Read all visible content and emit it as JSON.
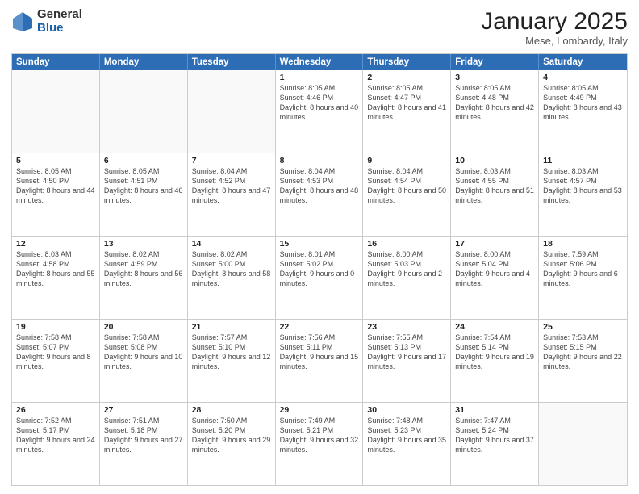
{
  "logo": {
    "general": "General",
    "blue": "Blue"
  },
  "title": "January 2025",
  "location": "Mese, Lombardy, Italy",
  "days_of_week": [
    "Sunday",
    "Monday",
    "Tuesday",
    "Wednesday",
    "Thursday",
    "Friday",
    "Saturday"
  ],
  "weeks": [
    [
      {
        "day": "",
        "info": ""
      },
      {
        "day": "",
        "info": ""
      },
      {
        "day": "",
        "info": ""
      },
      {
        "day": "1",
        "info": "Sunrise: 8:05 AM\nSunset: 4:46 PM\nDaylight: 8 hours\nand 40 minutes."
      },
      {
        "day": "2",
        "info": "Sunrise: 8:05 AM\nSunset: 4:47 PM\nDaylight: 8 hours\nand 41 minutes."
      },
      {
        "day": "3",
        "info": "Sunrise: 8:05 AM\nSunset: 4:48 PM\nDaylight: 8 hours\nand 42 minutes."
      },
      {
        "day": "4",
        "info": "Sunrise: 8:05 AM\nSunset: 4:49 PM\nDaylight: 8 hours\nand 43 minutes."
      }
    ],
    [
      {
        "day": "5",
        "info": "Sunrise: 8:05 AM\nSunset: 4:50 PM\nDaylight: 8 hours\nand 44 minutes."
      },
      {
        "day": "6",
        "info": "Sunrise: 8:05 AM\nSunset: 4:51 PM\nDaylight: 8 hours\nand 46 minutes."
      },
      {
        "day": "7",
        "info": "Sunrise: 8:04 AM\nSunset: 4:52 PM\nDaylight: 8 hours\nand 47 minutes."
      },
      {
        "day": "8",
        "info": "Sunrise: 8:04 AM\nSunset: 4:53 PM\nDaylight: 8 hours\nand 48 minutes."
      },
      {
        "day": "9",
        "info": "Sunrise: 8:04 AM\nSunset: 4:54 PM\nDaylight: 8 hours\nand 50 minutes."
      },
      {
        "day": "10",
        "info": "Sunrise: 8:03 AM\nSunset: 4:55 PM\nDaylight: 8 hours\nand 51 minutes."
      },
      {
        "day": "11",
        "info": "Sunrise: 8:03 AM\nSunset: 4:57 PM\nDaylight: 8 hours\nand 53 minutes."
      }
    ],
    [
      {
        "day": "12",
        "info": "Sunrise: 8:03 AM\nSunset: 4:58 PM\nDaylight: 8 hours\nand 55 minutes."
      },
      {
        "day": "13",
        "info": "Sunrise: 8:02 AM\nSunset: 4:59 PM\nDaylight: 8 hours\nand 56 minutes."
      },
      {
        "day": "14",
        "info": "Sunrise: 8:02 AM\nSunset: 5:00 PM\nDaylight: 8 hours\nand 58 minutes."
      },
      {
        "day": "15",
        "info": "Sunrise: 8:01 AM\nSunset: 5:02 PM\nDaylight: 9 hours\nand 0 minutes."
      },
      {
        "day": "16",
        "info": "Sunrise: 8:00 AM\nSunset: 5:03 PM\nDaylight: 9 hours\nand 2 minutes."
      },
      {
        "day": "17",
        "info": "Sunrise: 8:00 AM\nSunset: 5:04 PM\nDaylight: 9 hours\nand 4 minutes."
      },
      {
        "day": "18",
        "info": "Sunrise: 7:59 AM\nSunset: 5:06 PM\nDaylight: 9 hours\nand 6 minutes."
      }
    ],
    [
      {
        "day": "19",
        "info": "Sunrise: 7:58 AM\nSunset: 5:07 PM\nDaylight: 9 hours\nand 8 minutes."
      },
      {
        "day": "20",
        "info": "Sunrise: 7:58 AM\nSunset: 5:08 PM\nDaylight: 9 hours\nand 10 minutes."
      },
      {
        "day": "21",
        "info": "Sunrise: 7:57 AM\nSunset: 5:10 PM\nDaylight: 9 hours\nand 12 minutes."
      },
      {
        "day": "22",
        "info": "Sunrise: 7:56 AM\nSunset: 5:11 PM\nDaylight: 9 hours\nand 15 minutes."
      },
      {
        "day": "23",
        "info": "Sunrise: 7:55 AM\nSunset: 5:13 PM\nDaylight: 9 hours\nand 17 minutes."
      },
      {
        "day": "24",
        "info": "Sunrise: 7:54 AM\nSunset: 5:14 PM\nDaylight: 9 hours\nand 19 minutes."
      },
      {
        "day": "25",
        "info": "Sunrise: 7:53 AM\nSunset: 5:15 PM\nDaylight: 9 hours\nand 22 minutes."
      }
    ],
    [
      {
        "day": "26",
        "info": "Sunrise: 7:52 AM\nSunset: 5:17 PM\nDaylight: 9 hours\nand 24 minutes."
      },
      {
        "day": "27",
        "info": "Sunrise: 7:51 AM\nSunset: 5:18 PM\nDaylight: 9 hours\nand 27 minutes."
      },
      {
        "day": "28",
        "info": "Sunrise: 7:50 AM\nSunset: 5:20 PM\nDaylight: 9 hours\nand 29 minutes."
      },
      {
        "day": "29",
        "info": "Sunrise: 7:49 AM\nSunset: 5:21 PM\nDaylight: 9 hours\nand 32 minutes."
      },
      {
        "day": "30",
        "info": "Sunrise: 7:48 AM\nSunset: 5:23 PM\nDaylight: 9 hours\nand 35 minutes."
      },
      {
        "day": "31",
        "info": "Sunrise: 7:47 AM\nSunset: 5:24 PM\nDaylight: 9 hours\nand 37 minutes."
      },
      {
        "day": "",
        "info": ""
      }
    ]
  ]
}
